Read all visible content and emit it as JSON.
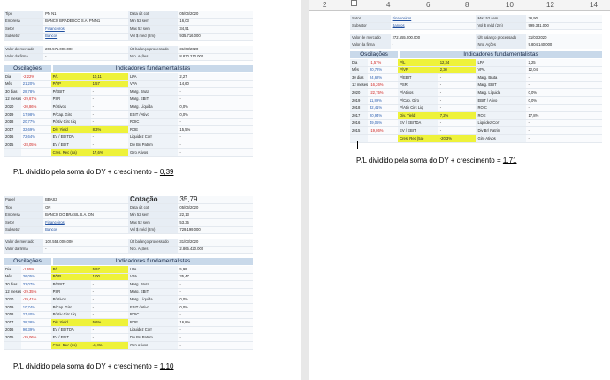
{
  "ruler": {
    "ticks": [
      "2",
      "4",
      "6",
      "8",
      "10",
      "12",
      "14"
    ]
  },
  "panel1": {
    "info": [
      [
        "Tipo",
        "PN N1",
        "Data últ cot",
        "05/06/2020"
      ],
      [
        "Empresa",
        "BANCO BRADESCO S.A. PN N1",
        "Min 52 sem",
        "16,03"
      ],
      [
        "Setor",
        "Financeiros",
        "Max 52 sem",
        "34,51"
      ],
      [
        "Subsetor",
        "Bancos",
        "Vol $ méd (2m)",
        "935.716.000"
      ]
    ],
    "market": [
      [
        "Valor de mercado",
        "203.571.000.000",
        "Últ balanço processado",
        "31/03/2020"
      ],
      [
        "Valor da firma",
        "-",
        "Nro. Ações",
        "8.870.210.000"
      ]
    ],
    "osc_header": "Oscilações",
    "ind_header": "Indicadores fundamentalistas",
    "rows": [
      [
        "Dia",
        "-2,22%",
        "P/L",
        "10,11",
        "LPA",
        "2,27"
      ],
      [
        "Mês",
        "21,20%",
        "P/VP",
        "1,57",
        "VPA",
        "14,60"
      ],
      [
        "30 dias",
        "28,78%",
        "P/EBIT",
        "-",
        "Marg. Bruta",
        "-"
      ],
      [
        "12 meses",
        "-29,67%",
        "PSR",
        "-",
        "Marg. EBIT",
        "-"
      ],
      [
        "2020",
        "-20,86%",
        "P/Ativos",
        "-",
        "Marg. Líquida",
        "0,0%"
      ],
      [
        "2019",
        "17,98%",
        "P/Cap. Giro",
        "-",
        "EBIT / Ativo",
        "0,0%"
      ],
      [
        "2018",
        "20,77%",
        "P/Ativ Circ Liq",
        "-",
        "ROIC",
        "-"
      ],
      [
        "2017",
        "32,69%",
        "Div. Yield",
        "8,3%",
        "ROE",
        "15,5%"
      ],
      [
        "2016",
        "72,64%",
        "EV / EBITDA",
        "-",
        "Liquidez Corr",
        "-"
      ],
      [
        "2015",
        "-28,05%",
        "EV / EBIT",
        "-",
        "Div Br/ Patrim",
        "-"
      ],
      [
        "",
        "",
        "Cres. Rec (5a)",
        "17,6%",
        "Giro Ativos",
        "-"
      ]
    ],
    "caption_text": "P/L dividido pela soma do DY + crescimento =",
    "caption_value": "0,39"
  },
  "panel2": {
    "info": [
      [
        "Setor",
        "Financeiros",
        "Max 52 sem",
        "36,90"
      ],
      [
        "Subsetor",
        "Bancos",
        "Vol $ méd (2m)",
        "999.331.000"
      ]
    ],
    "market": [
      [
        "Valor de mercado",
        "272.555.000.000",
        "Últ balanço processado",
        "31/03/2020"
      ],
      [
        "Valor da firma",
        "-",
        "Nro. Ações",
        "9.804.140.000"
      ]
    ],
    "osc_header": "Oscilações",
    "ind_header": "Indicadores fundamentalistas",
    "rows": [
      [
        "Dia",
        "-1,57%",
        "P/L",
        "12,34",
        "LPA",
        "2,25"
      ],
      [
        "Mês",
        "20,72%",
        "P/VP",
        "2,30",
        "VPA",
        "12,04"
      ],
      [
        "30 dias",
        "24,62%",
        "P/EBIT",
        "-",
        "Marg. Bruta",
        "-"
      ],
      [
        "12 meses",
        "-16,26%",
        "PSR",
        "-",
        "Marg. EBIT",
        "-"
      ],
      [
        "2020",
        "-22,75%",
        "P/Ativos",
        "-",
        "Marg. Líquida",
        "0,0%"
      ],
      [
        "2019",
        "11,89%",
        "P/Cap. Giro",
        "-",
        "EBIT / Ativo",
        "0,0%"
      ],
      [
        "2018",
        "32,41%",
        "P/Ativ Circ Liq",
        "-",
        "ROIC",
        "-"
      ],
      [
        "2017",
        "20,94%",
        "Div. Yield",
        "7,2%",
        "ROE",
        "17,8%"
      ],
      [
        "2016",
        "49,05%",
        "EV / EBITDA",
        "-",
        "Liquidez Corr",
        "-"
      ],
      [
        "2015",
        "-19,86%",
        "EV / EBIT",
        "-",
        "Div Br/ Patrim",
        "-"
      ],
      [
        "",
        "",
        "Cres. Rec (5a)",
        "-20,3%",
        "Giro Ativos",
        "-"
      ]
    ],
    "caption_text": "P/L dividido pela soma do DY + crescimento =",
    "caption_value": "1,71"
  },
  "panel3": {
    "info": [
      [
        "Papel",
        "BBAS3",
        "Cotação",
        "35,79"
      ],
      [
        "Tipo",
        "ON",
        "Data últ cot",
        "05/06/2020"
      ],
      [
        "Empresa",
        "BANCO DO BRASIL S.A. ON",
        "Min 52 sem",
        "22,13"
      ],
      [
        "Setor",
        "Financeiros",
        "Max 52 sem",
        "53,35"
      ],
      [
        "Subsetor",
        "Bancos",
        "Vol $ méd (2m)",
        "729.199.000"
      ]
    ],
    "market": [
      [
        "Valor de mercado",
        "102.553.000.000",
        "Últ balanço processado",
        "31/03/2020"
      ],
      [
        "Valor da firma",
        "-",
        "Nro. Ações",
        "2.865.420.000"
      ]
    ],
    "osc_header": "Oscilações",
    "ind_header": "Indicadores fundamentalistas",
    "rows": [
      [
        "Dia",
        "-1,65%",
        "P/L",
        "5,97",
        "LPA",
        "5,99"
      ],
      [
        "Mês",
        "36,05%",
        "P/VP",
        "1,00",
        "VPA",
        "35,47"
      ],
      [
        "30 dias",
        "32,07%",
        "P/EBIT",
        "-",
        "Marg. Bruta",
        "-"
      ],
      [
        "12 meses",
        "-29,35%",
        "PSR",
        "-",
        "Marg. EBIT",
        "-"
      ],
      [
        "2020",
        "-29,41%",
        "P/Ativos",
        "-",
        "Marg. Líquida",
        "0,0%"
      ],
      [
        "2019",
        "10,74%",
        "P/Cap. Giro",
        "-",
        "EBIT / Ativo",
        "0,0%"
      ],
      [
        "2018",
        "27,40%",
        "P/Ativ Circ Liq",
        "-",
        "ROIC",
        "-"
      ],
      [
        "2017",
        "38,38%",
        "Div. Yield",
        "5,6%",
        "ROE",
        "16,8%"
      ],
      [
        "2016",
        "96,39%",
        "EV / EBITDA",
        "-",
        "Liquidez Corr",
        "-"
      ],
      [
        "2015",
        "-29,06%",
        "EV / EBIT",
        "-",
        "Div Br/ Patrim",
        "-"
      ],
      [
        "",
        "",
        "Cres. Rec (5a)",
        "-0,4%",
        "Giro Ativos",
        "-"
      ]
    ],
    "caption_text": "P/L dividido pela soma do DY + crescimento =",
    "caption_value": "1,10"
  }
}
